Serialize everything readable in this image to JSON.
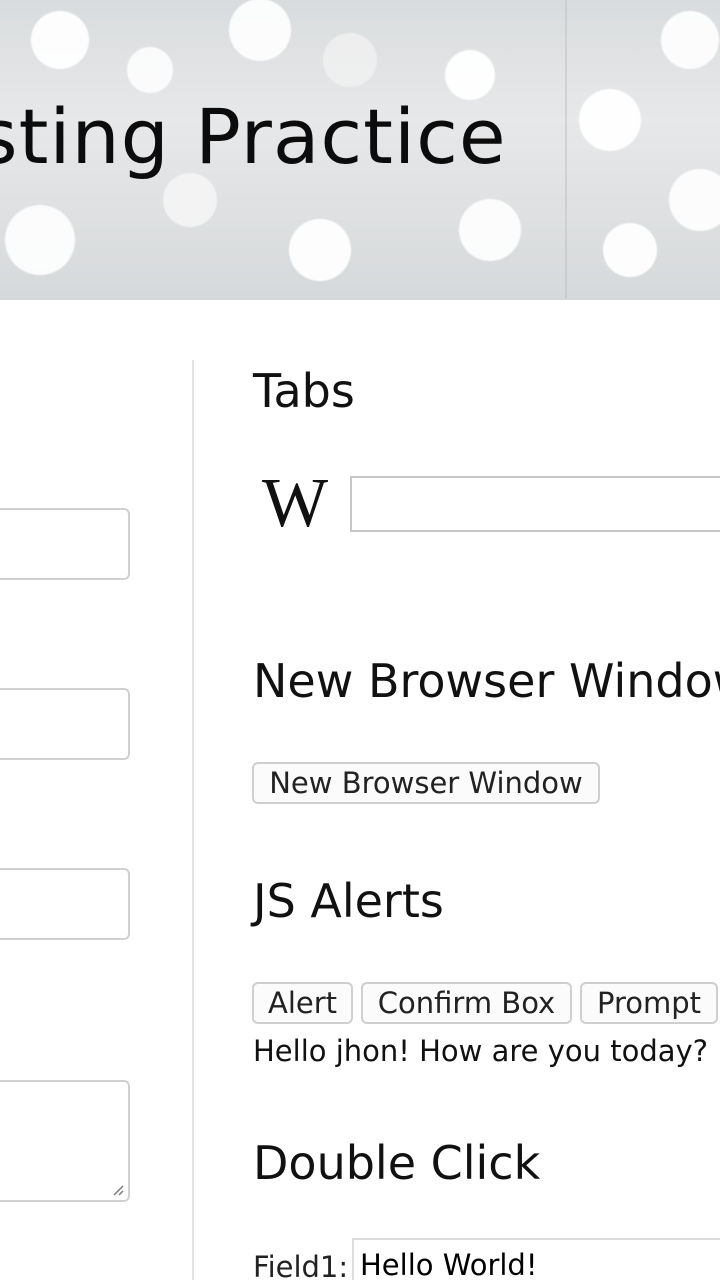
{
  "header": {
    "title": "sting Practice"
  },
  "sections": {
    "tabs": {
      "heading": "Tabs",
      "logo": "wikipedia-logo",
      "search_value": ""
    },
    "new_window": {
      "heading": "New Browser Window",
      "button_label": "New Browser Window"
    },
    "js_alerts": {
      "heading": "JS Alerts",
      "buttons": [
        "Alert",
        "Confirm Box",
        "Prompt"
      ],
      "message": "Hello jhon! How are you today?"
    },
    "double_click": {
      "heading": "Double Click",
      "field1_label": "Field1:",
      "field1_value": "Hello World!"
    }
  }
}
